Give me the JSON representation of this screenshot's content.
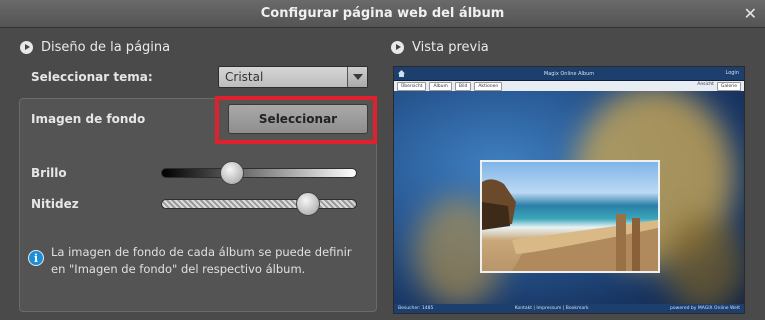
{
  "window": {
    "title": "Configurar página web del álbum",
    "close_icon": "close-icon"
  },
  "page_design": {
    "heading": "Diseño de la página",
    "theme_label": "Seleccionar tema:",
    "theme_value": "Cristal",
    "background_label": "Imagen de fondo",
    "select_button": "Seleccionar",
    "brightness_label": "Brillo",
    "brightness_value": 0.34,
    "sharpness_label": "Nitidez",
    "sharpness_value": 0.79,
    "info_text": "La imagen de fondo de cada álbum se puede definir en \"Imagen de fondo\" del respectivo álbum.",
    "info_icon": "info-icon",
    "highlight_color": "#e0202c"
  },
  "preview": {
    "heading": "Vista previa",
    "site_title": "Magix Online Album",
    "login": "Login",
    "nav": [
      "Übersicht",
      "Album",
      "Bild"
    ],
    "nav_action": "Aktionen",
    "view_label": "Ansicht",
    "view_value": "Galerie",
    "footer_left": "Besucher: 1485",
    "footer_mid": "Kontakt | Impressum | Bookmark",
    "footer_right": "powered by MAGIX Online Welt"
  }
}
